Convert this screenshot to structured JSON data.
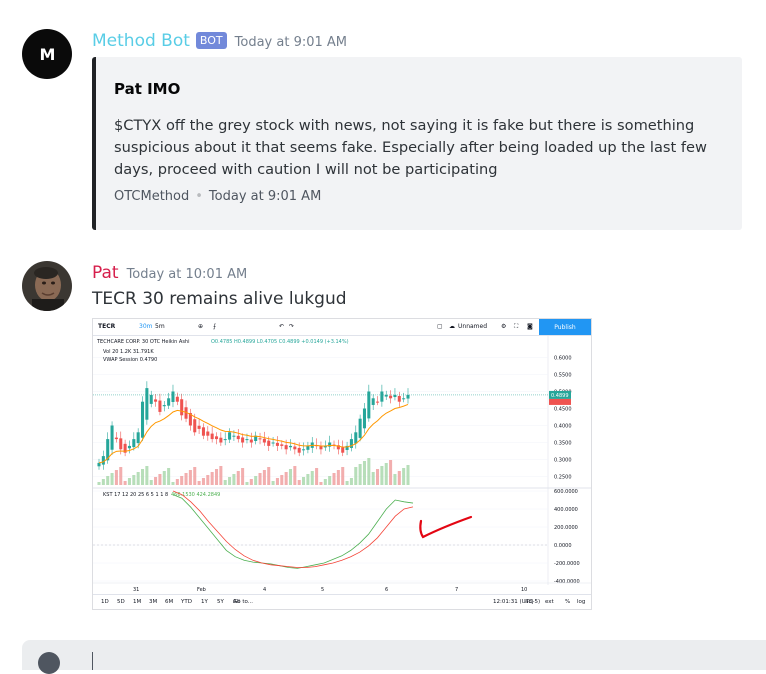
{
  "messages": [
    {
      "username": "Method Bot",
      "badge": "BOT",
      "timestamp": "Today at 9:01 AM",
      "avatar_letter": "M",
      "embed": {
        "title": "Pat IMO",
        "description": "$CTYX off the grey stock with news, not saying it is fake but there is something suspicious about it that seems fake. Especially after being loaded up the last few days, proceed with caution I will not be participating",
        "footer_author": "OTCMethod",
        "footer_time": "Today at 9:01 AM",
        "border_color": "#202225"
      }
    },
    {
      "username": "Pat",
      "timestamp": "Today at 10:01 AM",
      "text": "TECR 30 remains alive lukgud",
      "username_color": "#d61e4b"
    }
  ],
  "chart": {
    "toolbar": {
      "symbol": "TECR",
      "interval": "30m",
      "interval2": "5m",
      "layout_name": "Unnamed",
      "publish": "Publish"
    },
    "legend": {
      "title": "TECHCARE CORP.  30  OTC  Heikin Ashi",
      "ohlc": "O0.4785 H0.4899 L0.4705 C0.4899 +0.0149 (+3.14%)",
      "vol": "Vol 20  1.2K  31.791K",
      "vwap": "VWAP Session  0.4790",
      "kst": "KST 17 12 20 25 6 5 1 1 8",
      "kst_values": "466.1530  424.2849"
    },
    "price_axis": [
      "0.6000",
      "0.5500",
      "0.5000",
      "0.4500",
      "0.4000",
      "0.3500",
      "0.3000",
      "0.2500"
    ],
    "price_tag": "0.4899",
    "osc_axis": [
      "600.0000",
      "400.0000",
      "200.0000",
      "0.0000",
      "-200.0000",
      "-400.0000"
    ],
    "time_axis": [
      "31",
      "Feb",
      "4",
      "5",
      "6",
      "7",
      "10"
    ],
    "bottom": {
      "ranges": [
        "1D",
        "5D",
        "1M",
        "3M",
        "6M",
        "YTD",
        "1Y",
        "5Y",
        "All"
      ],
      "goto": "Go to...",
      "clock": "12:01:31 (UTC-5)",
      "options": [
        "adj",
        "ext",
        "%",
        "log",
        "auto"
      ]
    },
    "colors": {
      "up": "#26a69a",
      "down": "#ef5350",
      "vwap": "#ff9800",
      "kst": "#4caf50",
      "signal": "#f44336",
      "annotation": "#e30613"
    }
  },
  "chart_data": {
    "type": "candlestick",
    "title": "TECHCARE CORP. 30 OTC Heikin Ashi",
    "ylim": [
      0.225,
      0.625
    ],
    "x": [
      "31",
      "Feb",
      "4",
      "5",
      "6",
      "7",
      "10"
    ],
    "close": [
      0.29,
      0.31,
      0.36,
      0.4,
      0.36,
      0.33,
      0.32,
      0.34,
      0.36,
      0.38,
      0.47,
      0.51,
      0.49,
      0.47,
      0.44,
      0.46,
      0.48,
      0.5,
      0.47,
      0.43,
      0.42,
      0.4,
      0.38,
      0.39,
      0.37,
      0.37,
      0.36,
      0.36,
      0.35,
      0.36,
      0.38,
      0.37,
      0.36,
      0.35,
      0.36,
      0.35,
      0.37,
      0.36,
      0.35,
      0.34,
      0.35,
      0.34,
      0.34,
      0.33,
      0.34,
      0.33,
      0.32,
      0.33,
      0.34,
      0.35,
      0.34,
      0.33,
      0.34,
      0.35,
      0.34,
      0.33,
      0.32,
      0.34,
      0.36,
      0.38,
      0.42,
      0.45,
      0.5,
      0.48,
      0.47,
      0.5,
      0.49,
      0.48,
      0.49,
      0.47,
      0.48,
      0.49
    ],
    "vwap_last": 0.479,
    "volume_last_k": 31.791,
    "kst": {
      "value": 466.153,
      "signal": 424.2849
    }
  }
}
